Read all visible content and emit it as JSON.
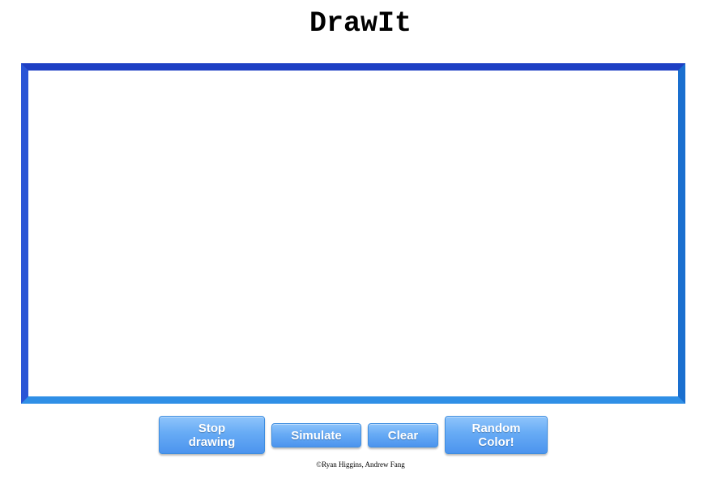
{
  "app": {
    "title": "DrawIt"
  },
  "canvas": {
    "frame_color": "#1e5fd6",
    "background": "#ffffff"
  },
  "toolbar": {
    "stop_drawing_label": "Stop drawing",
    "simulate_label": "Simulate",
    "clear_label": "Clear",
    "random_color_label": "Random Color!",
    "button_color": "#5aa2f2"
  },
  "footer": {
    "credits": "©Ryan Higgins, Andrew Fang"
  }
}
